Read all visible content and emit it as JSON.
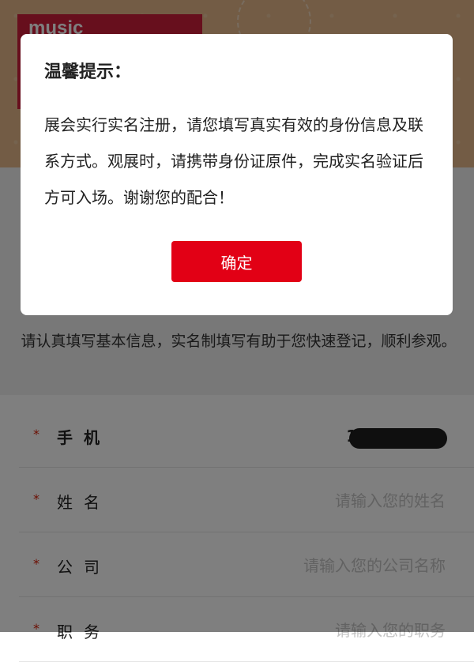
{
  "banner": {
    "logo_text": "music"
  },
  "notice": {
    "text": "请认真填写基本信息，实名制填写有助于您快速登记，顺利参观。"
  },
  "form": {
    "required_mark": "*",
    "fields": [
      {
        "label": "手机",
        "value": "1",
        "placeholder": ""
      },
      {
        "label": "姓名",
        "value": "",
        "placeholder": "请输入您的姓名"
      },
      {
        "label": "公司",
        "value": "",
        "placeholder": "请输入您的公司名称"
      },
      {
        "label": "职务",
        "value": "",
        "placeholder": "请输入您的职务"
      }
    ]
  },
  "modal": {
    "title": "温馨提示：",
    "body": "展会实行实名注册，请您填写真实有效的身份信息及联系方式。观展时，请携带身份证原件，完成实名验证后方可入场。谢谢您的配合！",
    "confirm_label": "确定"
  },
  "colors": {
    "accent": "#e20015",
    "required": "#d81e06",
    "banner_bg": "#e6b98a",
    "logo_bg": "#cf1f3b"
  }
}
